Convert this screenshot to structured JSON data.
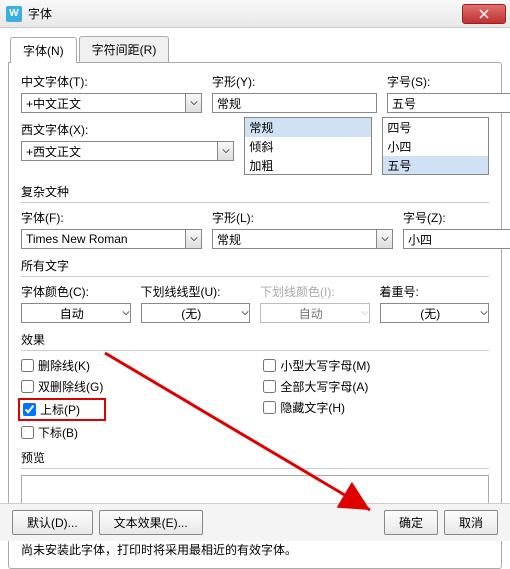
{
  "titlebar": {
    "title": "字体"
  },
  "tabs": {
    "font": "字体(N)",
    "spacing": "字符间距(R)"
  },
  "top": {
    "cn_label": "中文字体(T):",
    "cn_value": "+中文正文",
    "style_label": "字形(Y):",
    "style_value": "常规",
    "size_label": "字号(S):",
    "size_value": "五号",
    "en_label": "西文字体(X):",
    "en_value": "+西文正文",
    "style_list": [
      "常规",
      "倾斜",
      "加粗"
    ],
    "size_list": [
      "四号",
      "小四",
      "五号"
    ],
    "size_selected_index": 2
  },
  "complex": {
    "title": "复杂文种",
    "font_label": "字体(F):",
    "font_value": "Times New Roman",
    "style_label": "字形(L):",
    "style_value": "常规",
    "size_label": "字号(Z):",
    "size_value": "小四"
  },
  "all": {
    "title": "所有文字",
    "color_label": "字体颜色(C):",
    "color_value": "自动",
    "uline_label": "下划线线型(U):",
    "uline_value": "(无)",
    "ucolor_label": "下划线颜色(I):",
    "ucolor_value": "自动",
    "emph_label": "着重号:",
    "emph_value": "(无)"
  },
  "effects": {
    "title": "效果",
    "strike": "删除线(K)",
    "dblstrike": "双删除线(G)",
    "super": "上标(P)",
    "sub": "下标(B)",
    "smallcaps": "小型大写字母(M)",
    "allcaps": "全部大写字母(A)",
    "hidden": "隐藏文字(H)"
  },
  "preview": {
    "title": "预览"
  },
  "note": "尚未安装此字体，打印时将采用最相近的有效字体。",
  "footer": {
    "default": "默认(D)...",
    "text_effects": "文本效果(E)...",
    "ok": "确定",
    "cancel": "取消"
  }
}
